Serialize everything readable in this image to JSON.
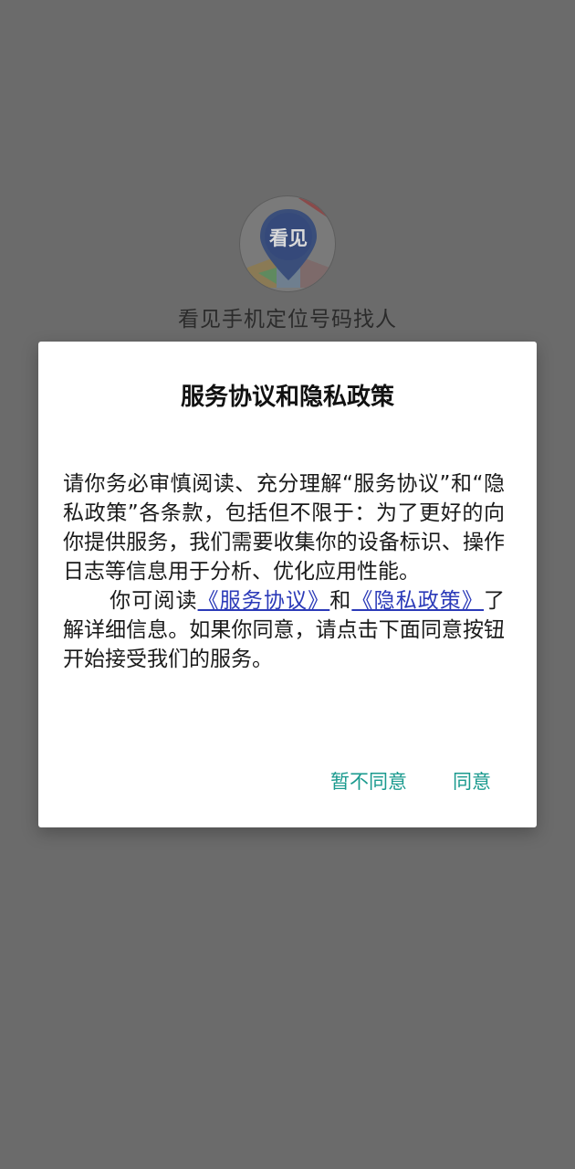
{
  "app": {
    "logo_text": "看见",
    "name": "看见手机定位号码找人"
  },
  "dialog": {
    "title": "服务协议和隐私政策",
    "paragraph1": "请你务必审慎阅读、充分理解“服务协议”和“隐私政策”各条款，包括但不限于：为了更好的向你提供服务，我们需要收集你的设备标识、操作日志等信息用于分析、优化应用性能。",
    "p2_prefix": "你可阅读",
    "link_service": "《服务协议》",
    "p2_and": "和",
    "link_privacy": "《隐私政策》",
    "p2_suffix": "了解详细信息。如果你同意，请点击下面同意按钮开始接受我们的服务。",
    "decline_label": "暂不同意",
    "agree_label": "同意"
  },
  "colors": {
    "overlay": "#6b6b6b",
    "link": "#2b3ab8",
    "accent": "#1a9a8e"
  },
  "icons": {
    "logo": "location-pin-icon"
  }
}
